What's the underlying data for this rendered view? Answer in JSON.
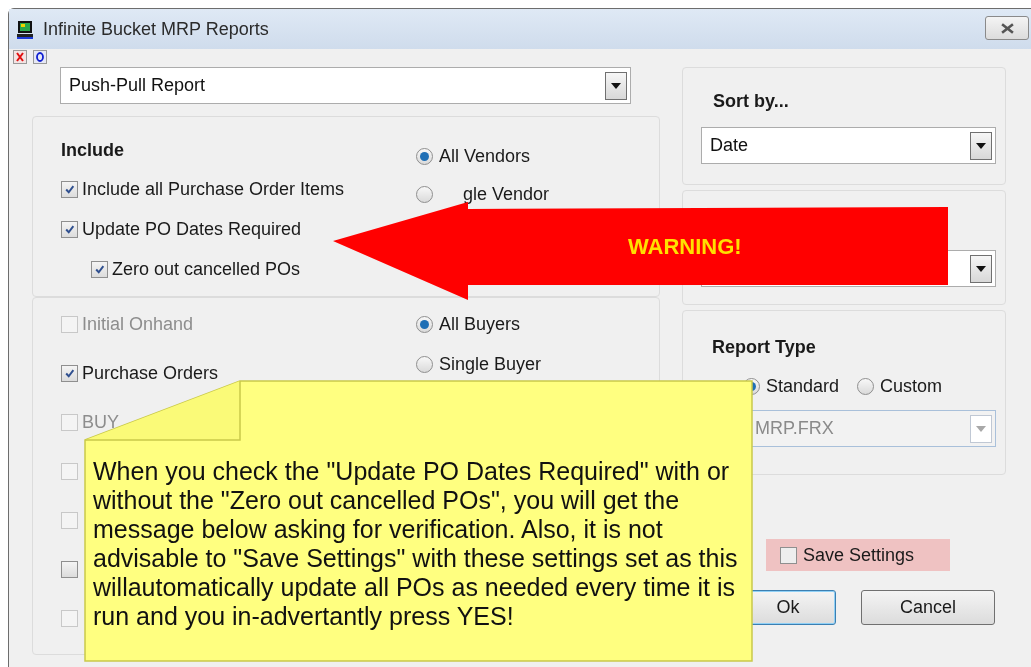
{
  "window": {
    "title": "Infinite Bucket MRP Reports"
  },
  "report_select": {
    "value": "Push-Pull Report"
  },
  "include_panel": {
    "heading": "Include",
    "checkboxes": [
      {
        "label": "Include all Purchase Order Items",
        "checked": true
      },
      {
        "label": "Update PO Dates Required",
        "checked": true,
        "children": [
          {
            "label": "Zero out cancelled POs",
            "checked": true
          }
        ]
      }
    ],
    "vendor_radios": [
      {
        "label": "All Vendors",
        "selected": true
      },
      {
        "label": "gle Vendor",
        "selected": false
      }
    ]
  },
  "source_panel": {
    "checkboxes": [
      {
        "label": "Initial Onhand",
        "checked": false,
        "disabled": true
      },
      {
        "label": "Purchase Orders",
        "checked": true,
        "disabled": false
      },
      {
        "label": "BUY",
        "checked": false,
        "disabled": true
      },
      {
        "checked": false,
        "disabled": true
      },
      {
        "checked": false,
        "disabled": true
      },
      {
        "checked": false,
        "disabled": false
      },
      {
        "checked": false,
        "disabled": true
      }
    ],
    "buyer_radios": [
      {
        "label": "All Buyers",
        "selected": true
      },
      {
        "label": "Single Buyer",
        "selected": false
      }
    ]
  },
  "sort_panel": {
    "heading": "Sort by...",
    "value": "Date"
  },
  "report_type_panel": {
    "heading": "Report Type",
    "radios": [
      {
        "label": "Standard",
        "selected": true
      },
      {
        "label": "Custom",
        "selected": false
      }
    ],
    "template": {
      "value": "MRP.FRX",
      "disabled": true
    }
  },
  "save_settings": {
    "label": "Save Settings",
    "checked": false
  },
  "buttons": [
    {
      "label": "Ok",
      "kind": "default"
    },
    {
      "label": "Cancel",
      "kind": "normal"
    }
  ],
  "annotations": {
    "arrow_label": "WARNING!",
    "callout": "When you check the \"Update PO Dates Required\" with or without the \"Zero out cancelled POs\", you will get the message below asking for verification. Also, it is not advisable to \"Save Settings\" with these settings set as this willautomatically update all POs as needed every time it is run and you in-advertantly press YES!"
  }
}
